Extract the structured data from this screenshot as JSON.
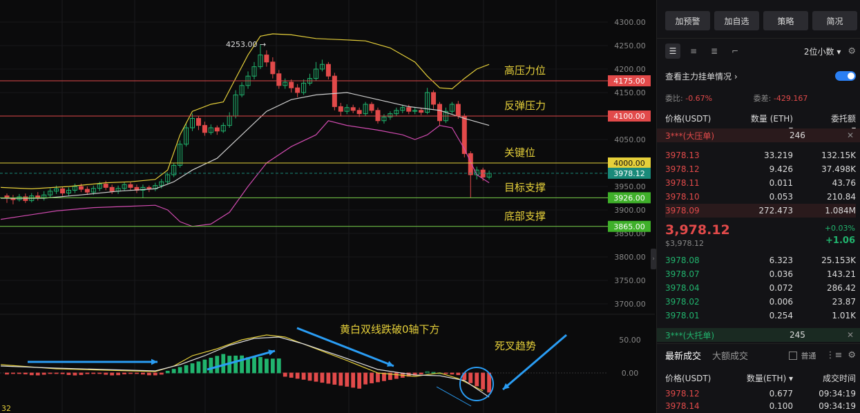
{
  "chart": {
    "price_axis": [
      "4300.00",
      "4250.00",
      "4200.00",
      "4150.00",
      "4050.00",
      "3950.00",
      "3900.00",
      "3850.00",
      "3800.00",
      "3750.00",
      "3700.00"
    ],
    "macd_axis": [
      "50.00",
      "0.00"
    ],
    "high_label": "4253.00 →",
    "left_time_label": "32",
    "levels": [
      {
        "price": "4175.00",
        "annotation": "高压力位",
        "color": "#e24a4a"
      },
      {
        "price": "4100.00",
        "annotation": "反弹压力",
        "color": "#e24a4a"
      },
      {
        "price": "4000.00",
        "annotation": "关键位",
        "color": "#e6d03a"
      },
      {
        "price": "3926.00",
        "annotation": "目标支撑",
        "color": "#7ad14a"
      },
      {
        "price": "3865.00",
        "annotation": "底部支撑",
        "color": "#7ad14a"
      }
    ],
    "current_price": "3978.12",
    "macd_annotation": "黄白双线跌破0轴下方",
    "death_cross_annotation": "死叉趋势",
    "colors": {
      "up": "#21b46e",
      "down": "#e24a4a",
      "yellow": "#e6d03a",
      "boll_mid": "#cfcfcf",
      "boll_low": "#d14bb0",
      "current": "#1a8a7a",
      "blue_arrow": "#2a9df4"
    }
  },
  "panel": {
    "buttons": [
      "加预警",
      "加自选",
      "策略",
      "简况"
    ],
    "decimal_label": "2位小数",
    "toggle_label": "查看主力挂单情况",
    "ratio": {
      "label1": "委比:",
      "value1": "-0.67%",
      "label2": "委差:",
      "value2": "-429.167"
    },
    "headers": {
      "price": "价格(USDT)",
      "qty": "数量 (ETH)",
      "total": "委托额"
    },
    "ask_big": {
      "label": "3***(大压单)",
      "count": "246"
    },
    "asks": [
      {
        "price": "3978.13",
        "qty": "33.219",
        "total": "132.15K"
      },
      {
        "price": "3978.12",
        "qty": "9.426",
        "total": "37.498K"
      },
      {
        "price": "3978.11",
        "qty": "0.011",
        "total": "43.76"
      },
      {
        "price": "3978.10",
        "qty": "0.053",
        "total": "210.84"
      },
      {
        "price": "3978.09",
        "qty": "272.473",
        "total": "1.084M"
      }
    ],
    "mid": {
      "price": "3,978.12",
      "sub": "$3,978.12",
      "pct": "+0.03%",
      "chg": "+1.06"
    },
    "bids": [
      {
        "price": "3978.08",
        "qty": "6.323",
        "total": "25.153K"
      },
      {
        "price": "3978.07",
        "qty": "0.036",
        "total": "143.21"
      },
      {
        "price": "3978.04",
        "qty": "0.072",
        "total": "286.42"
      },
      {
        "price": "3978.02",
        "qty": "0.006",
        "total": "23.87"
      },
      {
        "price": "3978.01",
        "qty": "0.254",
        "total": "1.01K"
      }
    ],
    "bid_big": {
      "label": "3***(大托单)",
      "count": "245"
    },
    "tabs": {
      "active": "最新成交",
      "other": "大额成交",
      "checkbox": "普通"
    },
    "trade_headers": {
      "price": "价格(USDT)",
      "qty": "数量(ETH)",
      "time": "成交时间"
    },
    "trades": [
      {
        "price": "3978.12",
        "qty": "0.677",
        "time": "09:34:19"
      },
      {
        "price": "3978.14",
        "qty": "0.100",
        "time": "09:34:19"
      }
    ]
  }
}
